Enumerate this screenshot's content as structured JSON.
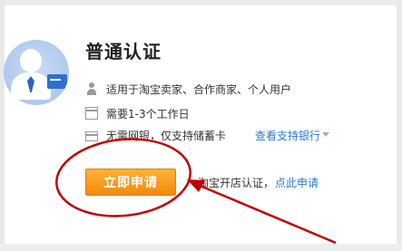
{
  "card": {
    "title": "普通认证",
    "features": [
      {
        "label": "适用于淘宝卖家、合作商家、个人用户",
        "icon": "person-icon"
      },
      {
        "label": "需要1-3个工作日",
        "icon": "calendar-icon"
      },
      {
        "label": "无需网银，仅支持储蓄卡",
        "icon": "bank-card-icon"
      }
    ],
    "bank_link": "查看支持银行",
    "apply_button": "立即申请",
    "taobao_text": "淘宝开店认证，",
    "apply_link": "点此申请"
  },
  "colors": {
    "button": "#f7941d",
    "link": "#2a7bd0",
    "annotation": "#c00000"
  }
}
